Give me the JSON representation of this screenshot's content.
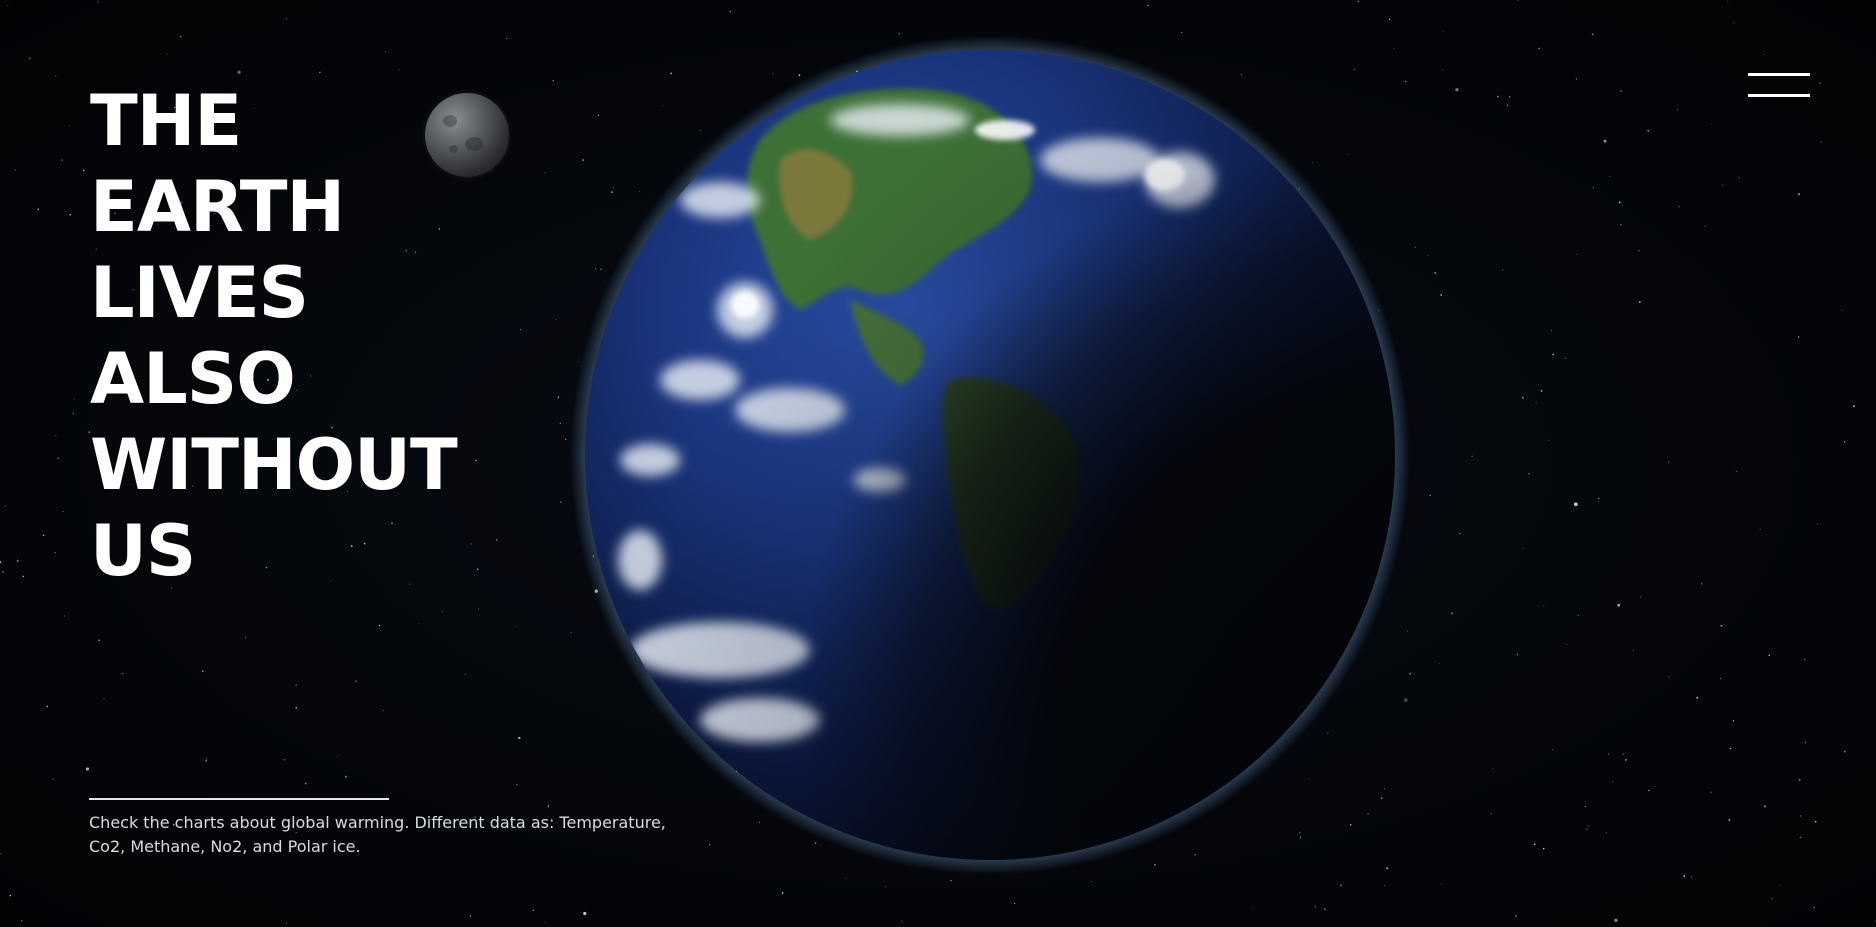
{
  "hero": {
    "headline_lines": [
      "THE",
      "EARTH",
      "LIVES",
      "ALSO",
      "WITHOUT",
      "US"
    ],
    "description": "Check the charts about global warming. Different data as: Temperature, Co2, Methane, No2, and Polar ice."
  },
  "nav": {
    "menu_icon": "hamburger-menu-icon"
  },
  "colors": {
    "background": "#04060a",
    "text": "#ffffff",
    "description_text": "#d9dde2",
    "ocean": "#1a3a8a",
    "land": "#3e7a3a"
  }
}
